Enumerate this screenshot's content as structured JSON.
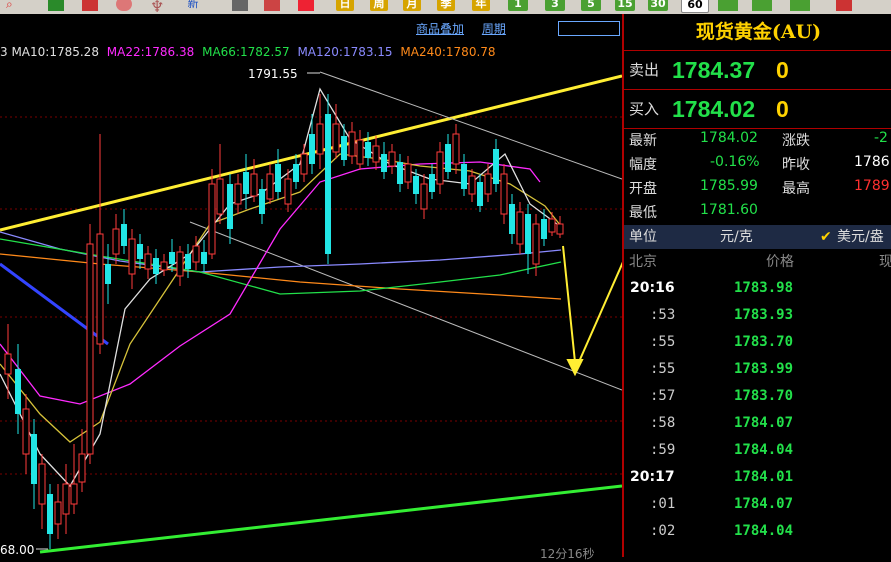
{
  "toolbar": {
    "buttons": [
      "新",
      "日",
      "周",
      "月",
      "季",
      "年",
      "1",
      "3",
      "5",
      "15",
      "30",
      "60"
    ]
  },
  "chart": {
    "ma_labels": [
      {
        "text": "3 MA10:1785.28",
        "color": "#e0e0e0"
      },
      {
        "text": "MA22:1786.38",
        "color": "#ff2bff"
      },
      {
        "text": "MA66:1782.57",
        "color": "#22e04a"
      },
      {
        "text": "MA120:1783.15",
        "color": "#8a8aff"
      },
      {
        "text": "MA240:1780.78",
        "color": "#ff8a1a"
      }
    ],
    "links": [
      "商品叠加",
      "周期"
    ],
    "high_marker": "1791.55",
    "low_marker": "68.00",
    "footer": "12分16秒"
  },
  "panel": {
    "title": "现货黄金(AU)",
    "sell_label": "卖出",
    "sell_price": "1784.37",
    "sell_vol": "0",
    "buy_label": "买入",
    "buy_price": "1784.02",
    "buy_vol": "0",
    "stats": {
      "latest_label": "最新",
      "latest": "1784.02",
      "change_label": "涨跌",
      "change": "-2",
      "range_label": "幅度",
      "range": "-0.16%",
      "prevclose_label": "昨收",
      "prevclose": "1786",
      "open_label": "开盘",
      "open": "1785.99",
      "high_label": "最高",
      "high": "1789",
      "low_label": "最低",
      "low": "1781.60"
    },
    "unit_label": "单位",
    "unit_value": "元/克",
    "currency": "美元/盎",
    "ticks_header": {
      "time": "北京",
      "price": "价格",
      "extra": "现"
    },
    "ticks": [
      {
        "time": "20:16",
        "price": "1783.98",
        "bold": true
      },
      {
        "time": ":53",
        "price": "1783.93"
      },
      {
        "time": ":55",
        "price": "1783.70"
      },
      {
        "time": ":55",
        "price": "1783.99"
      },
      {
        "time": ":57",
        "price": "1783.70"
      },
      {
        "time": ":58",
        "price": "1784.07"
      },
      {
        "time": ":59",
        "price": "1784.04"
      },
      {
        "time": "20:17",
        "price": "1784.01",
        "bold": true
      },
      {
        "time": ":01",
        "price": "1784.07"
      },
      {
        "time": ":02",
        "price": "1784.04"
      }
    ]
  }
}
